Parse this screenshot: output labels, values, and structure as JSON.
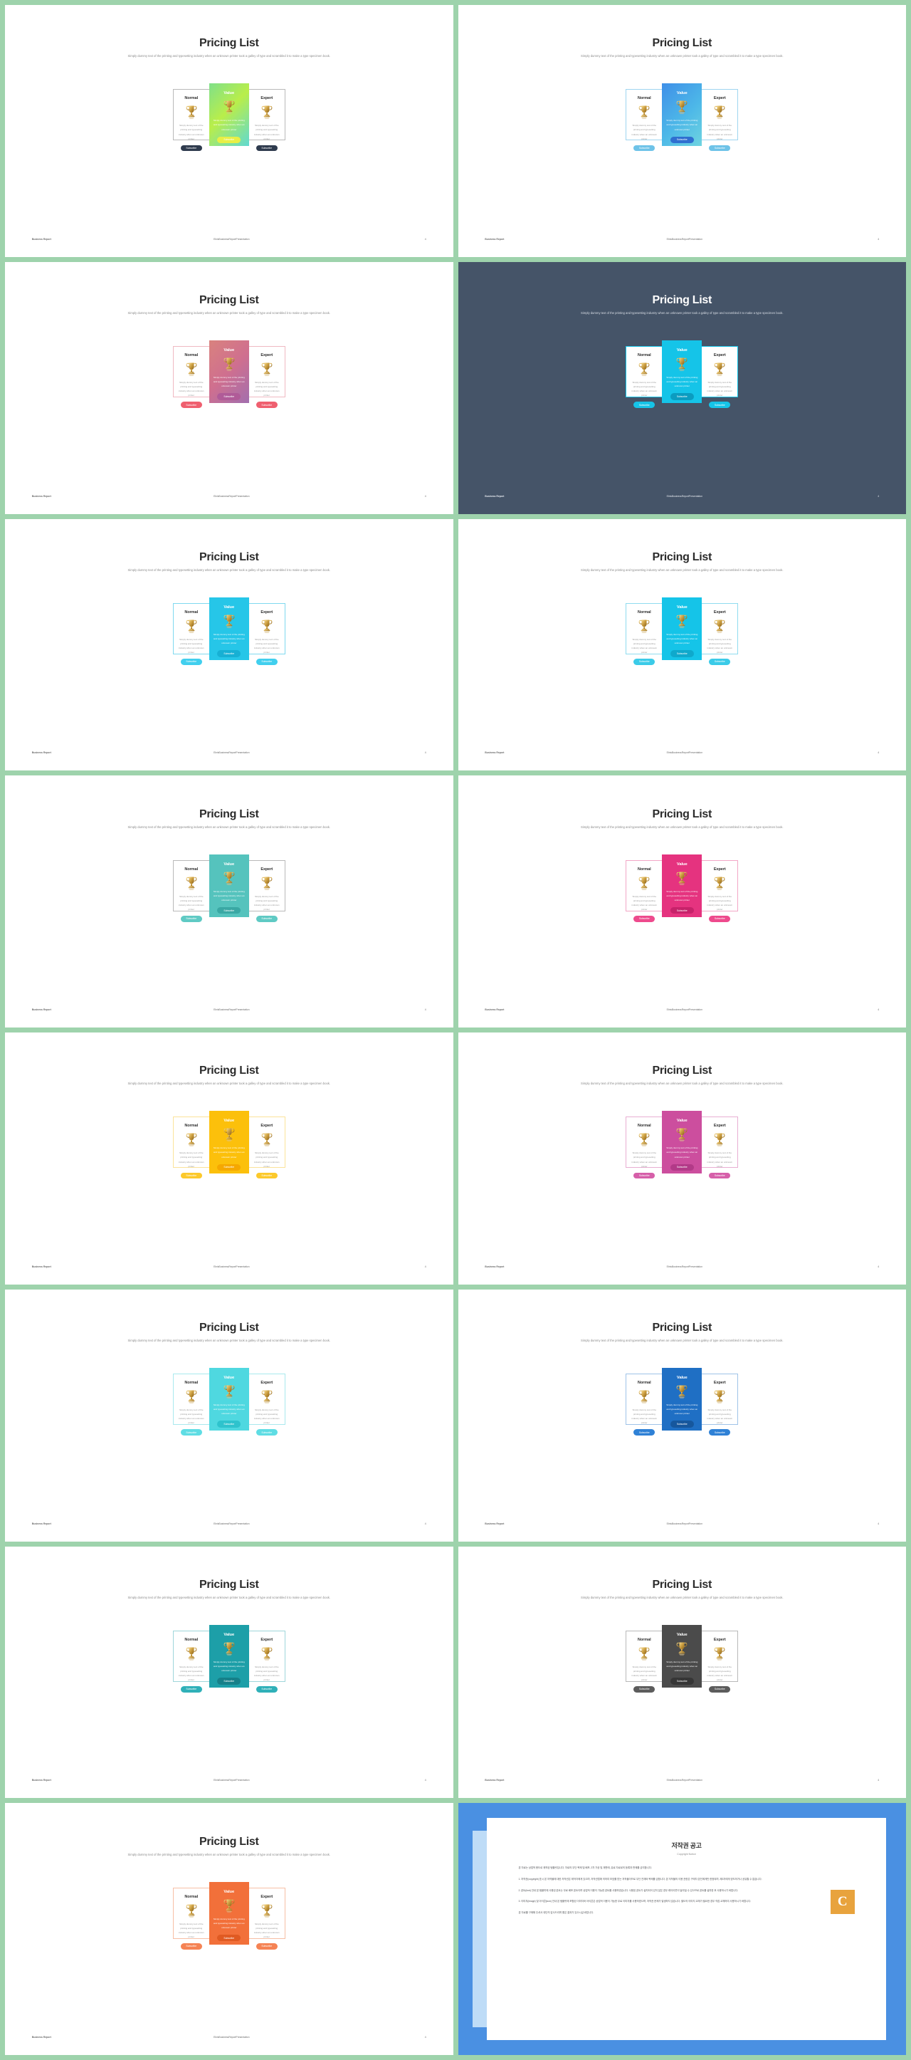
{
  "deck": {
    "title": "Pricing List",
    "subtitle": "Simply dummy text of the printing and typesetting industry when an unknown printer took a galley of type and scrambled it to make a type specimen book.",
    "card_description": "Simply dummy text of the printing and typesetting industry when an unknown printer",
    "subscribe_label": "Subscribe",
    "plans": [
      "Normal",
      "Value",
      "Expert"
    ],
    "footer": {
      "left": "Business Report",
      "center": "ElnisBusinessReportPresentation",
      "page": "4"
    },
    "sheet_background": "#9ed3ac"
  },
  "slides": [
    {
      "id": 1,
      "theme": "light",
      "accent": "#9ade4f",
      "mid_gradient": "linear-gradient(135deg, #7fe08a 0%, #b9ee4a 45%, #5fd9d2 100%)",
      "mid_button": "#e8ef45",
      "side_button": "#2f3b4e",
      "side_border": "#b9b9b9"
    },
    {
      "id": 2,
      "theme": "light",
      "accent": "#4aa3f0",
      "mid_gradient": "linear-gradient(135deg, #3f8fe8 0%, #4db8e8 55%, #6fd4e0 100%)",
      "mid_button": "#2f6fd0",
      "side_button": "#6ec3e8",
      "side_border": "#9ed5f0"
    },
    {
      "id": 3,
      "theme": "light",
      "accent": "#e0607d",
      "mid_gradient": "linear-gradient(135deg, #d9827e 0%, #cf6f8f 50%, #a26fae 100%)",
      "mid_button": "#b05b98",
      "side_button": "#ef5f6f",
      "side_border": "#f0b9c2"
    },
    {
      "id": 4,
      "theme": "dark",
      "accent": "#15c4e8",
      "mid_gradient": "#15c4e8",
      "mid_button": "#0b9cc0",
      "side_button": "#15c4e8",
      "side_border": "#15c4e8"
    },
    {
      "id": 5,
      "theme": "light",
      "accent": "#26c6e8",
      "mid_gradient": "#26c6e8",
      "mid_button": "#17b0d4",
      "side_button": "#41cfee",
      "side_border": "#7fd9ef"
    },
    {
      "id": 6,
      "theme": "light",
      "accent": "#15c4e8",
      "mid_gradient": "#15c4e8",
      "mid_button": "#0fa9cc",
      "side_button": "#3bcbe8",
      "side_border": "#8fdcef"
    },
    {
      "id": 7,
      "theme": "light",
      "accent": "#55c3bd",
      "mid_gradient": "#55c3bd",
      "mid_button": "#3aa8a4",
      "side_button": "#5fcac4",
      "side_border": "#b9b9b9"
    },
    {
      "id": 8,
      "theme": "light",
      "accent": "#e5337f",
      "mid_gradient": "#e5337f",
      "mid_button": "#c7226a",
      "side_button": "#ee4a8d",
      "side_border": "#f2a6c6"
    },
    {
      "id": 9,
      "theme": "light",
      "accent": "#fcc00b",
      "mid_gradient": "#fcc00b",
      "mid_button": "#f5a800",
      "side_button": "#fcc92b",
      "side_border": "#fbe39a"
    },
    {
      "id": 10,
      "theme": "light",
      "accent": "#cc4e9e",
      "mid_gradient": "#cc4e9e",
      "mid_button": "#b23a88",
      "side_button": "#d65fa9",
      "side_border": "#e8aed2"
    },
    {
      "id": 11,
      "theme": "light",
      "accent": "#4fd8e0",
      "mid_gradient": "#4fd8e0",
      "mid_button": "#2ec3cd",
      "side_button": "#5fdde4",
      "side_border": "#a9e9ee"
    },
    {
      "id": 12,
      "theme": "light",
      "accent": "#1f6fc4",
      "mid_gradient": "#1f6fc4",
      "mid_button": "#16579d",
      "side_button": "#2f81d6",
      "side_border": "#9fc3e8"
    },
    {
      "id": 13,
      "theme": "light",
      "accent": "#1d9fa8",
      "mid_gradient": "#1d9fa8",
      "mid_button": "#168089",
      "side_button": "#2fb0b8",
      "side_border": "#9fd6da"
    },
    {
      "id": 14,
      "theme": "light",
      "accent": "#4b4b4b",
      "mid_gradient": "#4b4b4b",
      "mid_button": "#363636",
      "side_button": "#5c5c5c",
      "side_border": "#b9b9b9"
    },
    {
      "id": 15,
      "theme": "light",
      "accent": "#f2703a",
      "mid_gradient": "#f2703a",
      "mid_button": "#e05a22",
      "side_button": "#f58354",
      "side_border": "#f7bfa5"
    }
  ],
  "copyright_slide": {
    "title": "저작권 공고",
    "subtitle": "Copyright Notice",
    "paragraphs": [
      "본 자료는 상업적 용도로 제작된 템플릿입니다. 자료의 무단 복제 및 배포, 2차 가공 및 재판매, 유료 자료로의 등록과 판매를 금지합니다.",
      "1. 저작권(copyright) 표시 본 저작물에 대한 저작권은 제작자에게 있으며, 저작권법에 의하여 보호를 받는 저작물이므로 무단 전재와 복제를 금합니다. 본 저작물의 이용 권한은 구매자 본인에게만 한정되며, 제3자에게 양도하거나 공유할 수 없습니다.",
      "2. 폰트(font) 안내 본 템플릿에 사용된 폰트는 무료 배포 폰트이며 상업적 이용이 가능한 폰트를 사용하였습니다. 사용된 폰트가 설치되어 있지 않은 경우 레이아웃이 달라질 수 있으므로 폰트를 설치한 후 사용하시기 바랍니다.",
      "3. 이미지(image) 및 아이콘(icon) 안내 본 템플릿에 포함된 이미지와 아이콘은 상업적 이용이 가능한 무료 이미지를 사용하였으며, 저작권 문제가 발생하지 않습니다. 별도의 이미지 교체가 필요한 경우 직접 교체하여 사용하시기 바랍니다.",
      "본 자료를 구매해 주셔서 대단히 감사드리며 좋은 결과가 있으시길 바랍니다."
    ],
    "logo_letter": "C",
    "background": "#4a90e2"
  }
}
